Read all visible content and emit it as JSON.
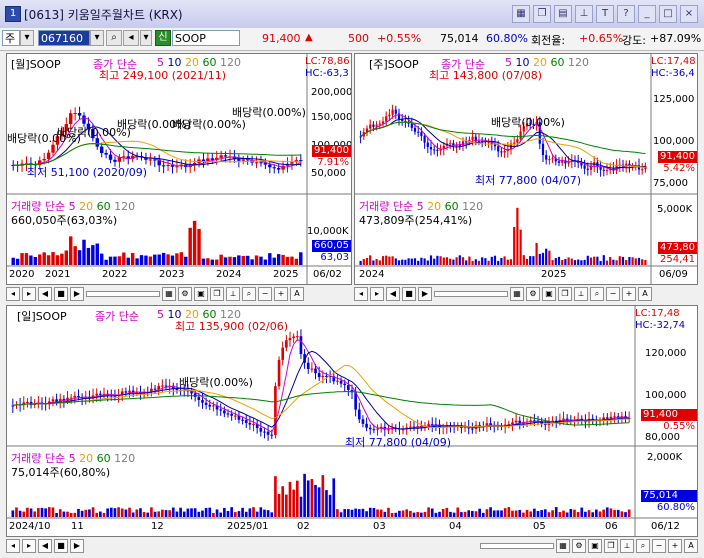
{
  "window": {
    "number": "1",
    "title": "[0613] 키움일주월차트 (KRX)",
    "title_icons": [
      "grid-icon",
      "copy-icon",
      "layout-icon",
      "pin-icon",
      "text-icon",
      "help-icon",
      "minimize-icon",
      "maximize-icon",
      "close-icon"
    ]
  },
  "toolbar": {
    "market": "주",
    "code": "067160",
    "credit_badge": "신",
    "name": "SOOP",
    "price": "91,400",
    "change": "500",
    "change_pct": "+0.55%",
    "volume": "75,014",
    "volume_ratio": "60.80%",
    "turnover_label": "회전율:",
    "turnover": "+0.65%",
    "strength_label": "강도:",
    "strength": "+87.09%"
  },
  "monthly": {
    "title": "[월]SOOP",
    "ma_label": "종가 단순",
    "ma_periods": [
      "5",
      "10",
      "20",
      "60",
      "120"
    ],
    "max_label": "최고 249,100 (2021/11)",
    "min_label": "최저 51,100 (2020/09)",
    "div_labels": [
      "배당락(0.00%)",
      "배당락(0.00%)",
      "배당락(0.00%)",
      "배당락(0.00%)",
      "배당락(0.00%)",
      "배당락(0.00%)"
    ],
    "lc": "LC:78,86",
    "hc": "HC:-63,3",
    "y_ticks": [
      "200,000",
      "150,000",
      "100,000",
      "50,000"
    ],
    "price_tag": "91,400",
    "pct_tag": "7.91%",
    "vol_label": "거래량",
    "vol_ma_label": "단순",
    "vol_ma_periods": [
      "5",
      "20",
      "60",
      "120"
    ],
    "vol_value": "660,050주(63,03%)",
    "vol_ticks": [
      "10,000K"
    ],
    "vol_tag": "660,05",
    "vol_tag2": "63,03",
    "x_ticks": [
      "2020",
      "2021",
      "2022",
      "2023",
      "2024",
      "2025"
    ],
    "date_end": "06/02"
  },
  "weekly": {
    "title": "[주]SOOP",
    "ma_label": "종가 단순",
    "ma_periods": [
      "5",
      "10",
      "20",
      "60",
      "120"
    ],
    "max_label": "최고 143,800 (07/08)",
    "min_label": "최저 77,800 (04/07)",
    "div_labels": [
      "배당락(0.00%)"
    ],
    "lc": "LC:17,48",
    "hc": "HC:-36,4",
    "y_ticks": [
      "125,000",
      "100,000",
      "75,000"
    ],
    "price_tag": "91,400",
    "pct_tag": "5.42%",
    "vol_label": "거래량",
    "vol_ma_label": "단순",
    "vol_ma_periods": [
      "5",
      "20",
      "60",
      "120"
    ],
    "vol_value": "473,809주(254,41%)",
    "vol_ticks": [
      "5,000K"
    ],
    "vol_tag": "473,80",
    "vol_tag2": "254,41",
    "x_ticks": [
      "2024",
      "2025"
    ],
    "date_end": "06/09"
  },
  "daily": {
    "title": "[일]SOOP",
    "ma_label": "종가 단순",
    "ma_periods": [
      "5",
      "10",
      "20",
      "60",
      "120"
    ],
    "max_label": "최고 135,900 (02/06)",
    "min_label": "최저 77,800 (04/09)",
    "div_labels": [
      "배당락(0.00%)"
    ],
    "lc": "LC:17,48",
    "hc": "HC:-32,74",
    "y_ticks": [
      "120,000",
      "100,000",
      "80,000"
    ],
    "price_tag": "91,400",
    "pct_tag": "0.55%",
    "vol_label": "거래량",
    "vol_ma_label": "단순",
    "vol_ma_periods": [
      "5",
      "20",
      "60",
      "120"
    ],
    "vol_value": "75,014주(60,80%)",
    "vol_ticks": [
      "2,000K"
    ],
    "vol_tag": "75,014",
    "vol_tag2": "60.80%",
    "x_ticks": [
      "2024/10",
      "11",
      "12",
      "2025/01",
      "02",
      "03",
      "04",
      "05",
      "06"
    ],
    "date_end": "06/12"
  },
  "colors": {
    "up": "#e00000",
    "down": "#0000e0",
    "ma5": "#d000d0",
    "ma10": "#0000a0",
    "ma20": "#f0a000",
    "ma60": "#008000",
    "ma120": "#808080",
    "tag_red": "#e00000",
    "tag_blue": "#0000e0"
  }
}
